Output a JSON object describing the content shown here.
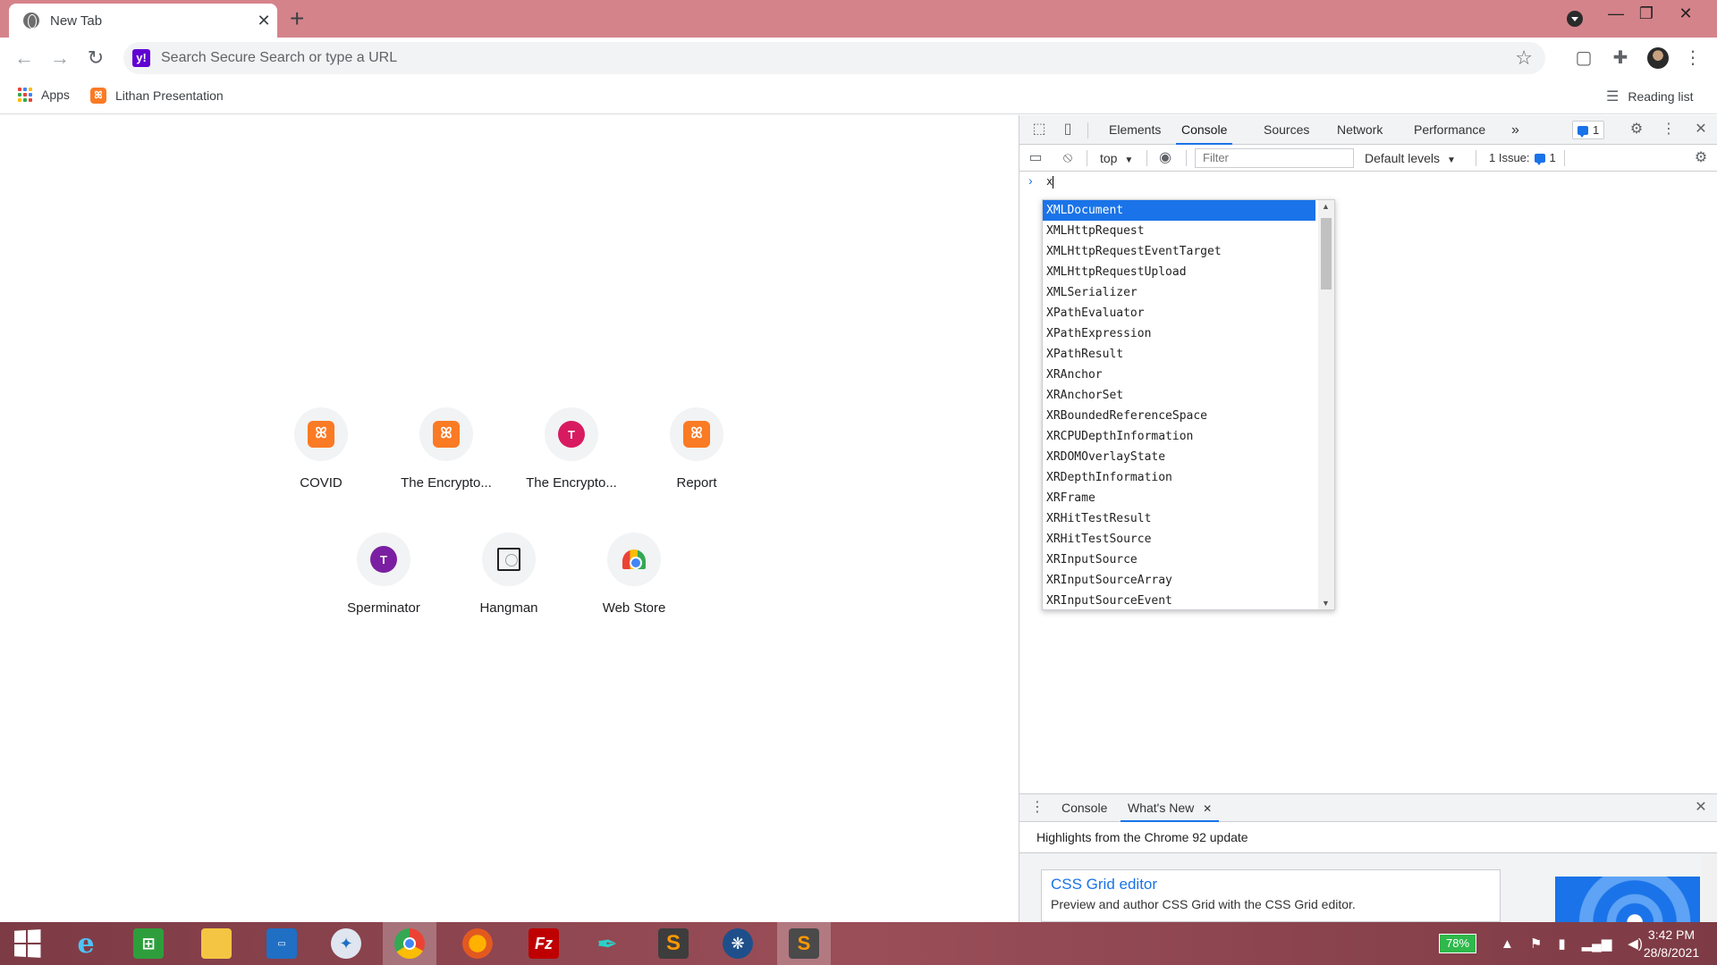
{
  "browser": {
    "tab_title": "New Tab",
    "tab_close": "✕",
    "new_tab": "+",
    "omnibox_placeholder": "Search Secure Search or type a URL",
    "search_provider_glyph": "y!",
    "window_controls": {
      "minimize": "—",
      "restore": "❐",
      "close": "✕"
    }
  },
  "bookmarks": [
    {
      "label": "Apps",
      "icon": "apps-grid-icon"
    },
    {
      "label": "Lithan Presentation",
      "icon": "xampp-icon"
    }
  ],
  "reading_list": "Reading list",
  "shortcuts": [
    {
      "label": "COVID",
      "icon": "xampp-icon"
    },
    {
      "label": "The Encrypto...",
      "icon": "xampp-icon"
    },
    {
      "label": "The Encrypto...",
      "icon": "letter-icon",
      "letter": "T",
      "color": "#d81b60"
    },
    {
      "label": "Report",
      "icon": "xampp-icon"
    },
    {
      "label": "Sperminator",
      "icon": "letter-icon",
      "letter": "T",
      "color": "#7b1fa2"
    },
    {
      "label": "Hangman",
      "icon": "hangman-icon"
    },
    {
      "label": "Web Store",
      "icon": "webstore-icon"
    }
  ],
  "devtools": {
    "tabs": [
      "Elements",
      "Console",
      "Sources",
      "Network",
      "Performance"
    ],
    "active_tab": "Console",
    "more_tabs": "»",
    "message_count": "1",
    "context": "top",
    "filter_placeholder": "Filter",
    "levels": "Default levels",
    "issues_label": "1 Issue:",
    "issues_count": "1",
    "console_input": "x",
    "autocomplete": [
      "XMLDocument",
      "XMLHttpRequest",
      "XMLHttpRequestEventTarget",
      "XMLHttpRequestUpload",
      "XMLSerializer",
      "XPathEvaluator",
      "XPathExpression",
      "XPathResult",
      "XRAnchor",
      "XRAnchorSet",
      "XRBoundedReferenceSpace",
      "XRCPUDepthInformation",
      "XRDOMOverlayState",
      "XRDepthInformation",
      "XRFrame",
      "XRHitTestResult",
      "XRHitTestSource",
      "XRInputSource",
      "XRInputSourceArray",
      "XRInputSourceEvent"
    ],
    "drawer_tabs": [
      "Console",
      "What's New"
    ],
    "drawer_active": "What's New",
    "whats_new_heading": "Highlights from the Chrome 92 update",
    "card_title": "CSS Grid editor",
    "card_desc": "Preview and author CSS Grid with the CSS Grid editor."
  },
  "taskbar": {
    "battery": "78%",
    "time": "3:42 PM",
    "date": "28/8/2021"
  }
}
